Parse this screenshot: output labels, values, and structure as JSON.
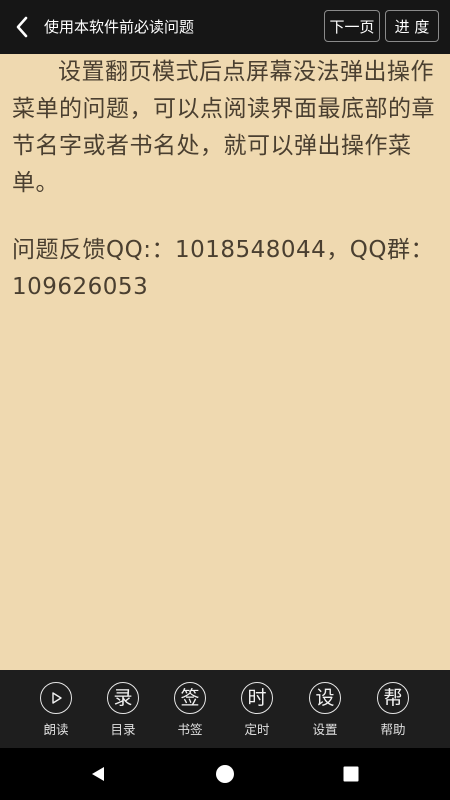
{
  "header": {
    "title": "使用本软件前必读问题",
    "next_label": "下一页",
    "progress_label": "进 度"
  },
  "content": {
    "paragraph1": "设置翻页模式后点屏幕没法弹出操作菜单的问题，可以点阅读界面最底部的章节名字或者书名处，就可以弹出操作菜单。",
    "paragraph2": "问题反馈QQ:：1018548044，QQ群：109626053"
  },
  "toolbar": {
    "items": [
      {
        "glyph": "",
        "label": "朗读",
        "icon": "play-icon"
      },
      {
        "glyph": "录",
        "label": "目录",
        "icon": "catalog-icon"
      },
      {
        "glyph": "签",
        "label": "书签",
        "icon": "bookmark-icon"
      },
      {
        "glyph": "时",
        "label": "定时",
        "icon": "timer-icon"
      },
      {
        "glyph": "设",
        "label": "设置",
        "icon": "settings-icon"
      },
      {
        "glyph": "帮",
        "label": "帮助",
        "icon": "help-icon"
      }
    ]
  },
  "colors": {
    "page_background": "#efd9b0",
    "text": "#4a3f30",
    "bar_background": "#161616"
  }
}
